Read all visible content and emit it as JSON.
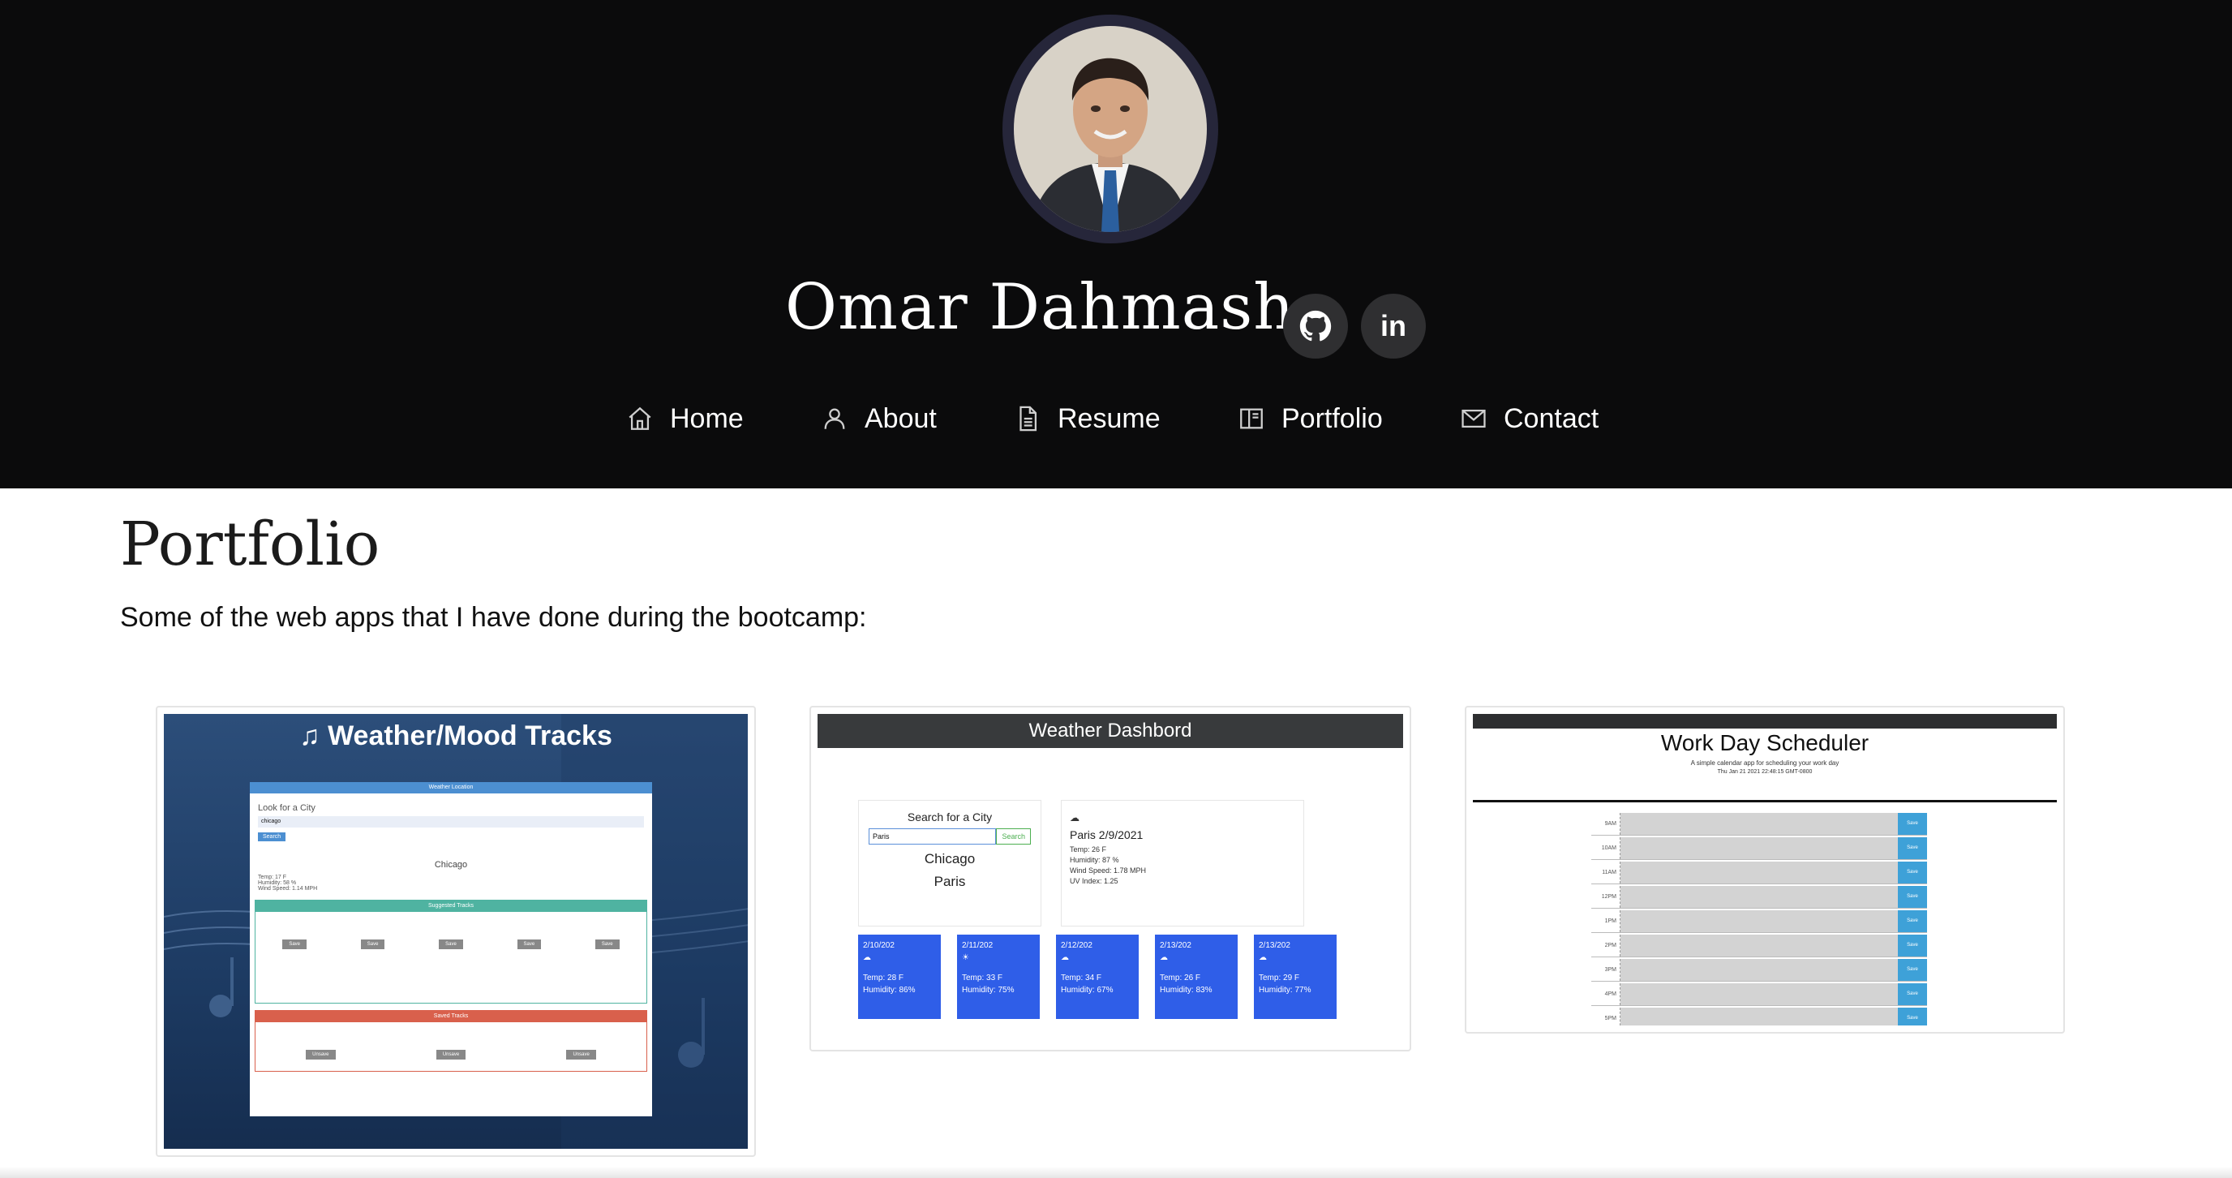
{
  "header": {
    "name": "Omar Dahmash",
    "avatar_alt": "profile-photo",
    "social": {
      "github_icon": "github-icon",
      "linkedin_label": "in"
    },
    "nav": [
      {
        "label": "Home",
        "icon": "home-icon"
      },
      {
        "label": "About",
        "icon": "person-icon"
      },
      {
        "label": "Resume",
        "icon": "document-icon"
      },
      {
        "label": "Portfolio",
        "icon": "book-icon"
      },
      {
        "label": "Contact",
        "icon": "mail-icon"
      }
    ]
  },
  "main": {
    "title": "Portfolio",
    "intro": "Some of the web apps that I have done during the bootcamp:",
    "projects": [
      {
        "thumb_title": "Weather/Mood Tracks",
        "panel_header": "Weather Location",
        "search_label": "Look for a City",
        "search_value": "chicago",
        "search_button": "Search",
        "city": "Chicago",
        "stats": [
          "Temp: 17 F",
          "Humidity: 58 %",
          "Wind Speed: 1.14 MPH"
        ],
        "suggested_header": "Suggested Tracks",
        "saved_header": "Saved Tracks",
        "save_label": "Save",
        "unsave_label": "Unsave"
      },
      {
        "thumb_title": "Weather Dashbord",
        "search_label": "Search for a City",
        "search_value": "Paris",
        "search_button": "Search",
        "history": [
          "Chicago",
          "Paris"
        ],
        "current_title": "Paris 2/9/2021",
        "current_stats": [
          "Temp: 26 F",
          "Humidity: 87 %",
          "Wind Speed: 1.78 MPH",
          "UV Index: 1.25"
        ],
        "forecast": [
          {
            "date": "2/10/202",
            "temp": "Temp: 28 F",
            "humidity": "Humidity: 86%"
          },
          {
            "date": "2/11/202",
            "temp": "Temp: 33 F",
            "humidity": "Humidity: 75%"
          },
          {
            "date": "2/12/202",
            "temp": "Temp: 34 F",
            "humidity": "Humidity: 67%"
          },
          {
            "date": "2/13/202",
            "temp": "Temp: 26 F",
            "humidity": "Humidity: 83%"
          },
          {
            "date": "2/13/202",
            "temp": "Temp: 29 F",
            "humidity": "Humidity: 77%"
          }
        ]
      },
      {
        "thumb_title": "Work Day Scheduler",
        "subtitle": "A simple calendar app for scheduling your work day",
        "date_line": "Thu Jan 21 2021 22:48:15 GMT-0800",
        "hours": [
          "9AM",
          "10AM",
          "11AM",
          "12PM",
          "1PM",
          "2PM",
          "3PM",
          "4PM",
          "5PM"
        ],
        "save_label": "Save"
      }
    ]
  },
  "colors": {
    "header_bg": "#0b0b0c",
    "avatar_ring": "#26263a",
    "dashboard_card": "#2f5ee8",
    "scheduler_save": "#3ea1d8"
  }
}
